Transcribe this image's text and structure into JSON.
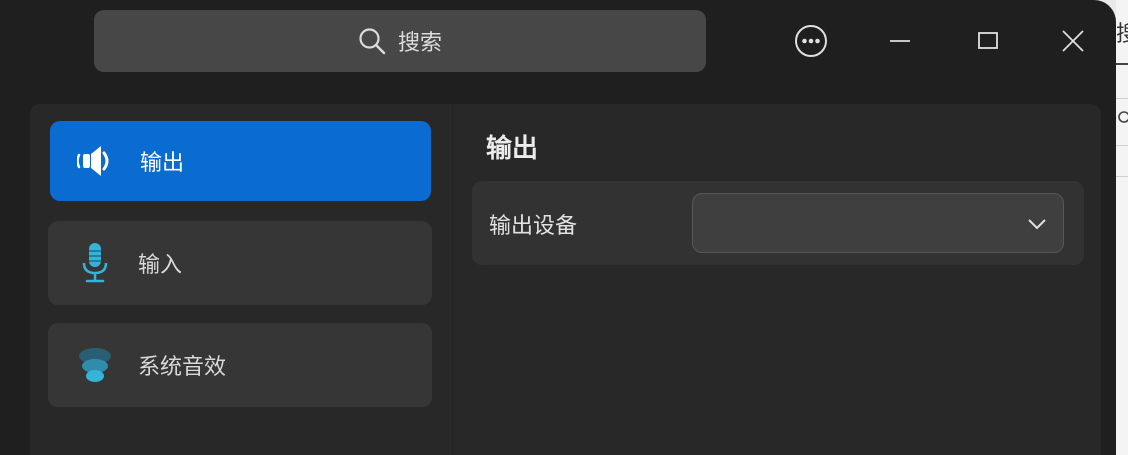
{
  "search": {
    "label": "搜索",
    "icon": "search-icon"
  },
  "titlebar": {
    "buttons": [
      "more-options-icon",
      "minimize-icon",
      "maximize-icon",
      "close-icon"
    ]
  },
  "sidebar": {
    "items": [
      {
        "label": "输出",
        "icon": "speaker-icon",
        "active": true
      },
      {
        "label": "输入",
        "icon": "microphone-icon",
        "active": false
      },
      {
        "label": "系统音效",
        "icon": "sound-effects-icon",
        "active": false
      }
    ]
  },
  "main": {
    "title": "输出",
    "output_device": {
      "label": "输出设备",
      "value": ""
    }
  },
  "colors": {
    "accent": "#0a6bd1",
    "window_bg": "#1f1f1f",
    "panel_bg": "#282828",
    "icon_cyan": "#35b3d8"
  }
}
